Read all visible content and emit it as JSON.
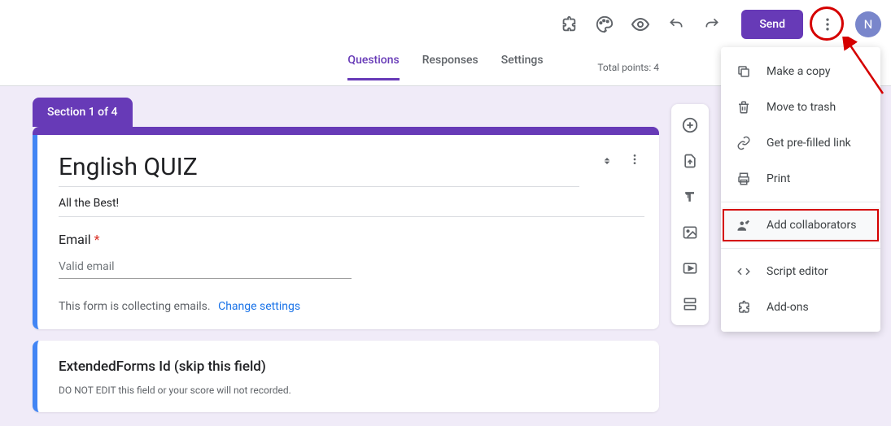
{
  "topbar": {
    "send_label": "Send",
    "avatar_initial": "N"
  },
  "tabs": {
    "questions": "Questions",
    "responses": "Responses",
    "settings": "Settings"
  },
  "total_points": "Total points: 4",
  "section_label": "Section 1 of 4",
  "form": {
    "title": "English QUIZ",
    "description": "All the Best!",
    "email_label": "Email",
    "email_required_mark": "*",
    "email_placeholder": "Valid email",
    "collecting_text": "This form is collecting emails.",
    "change_settings": "Change settings"
  },
  "question2": {
    "title": "ExtendedForms Id (skip this field)",
    "desc": "DO NOT EDIT this field or your score will not recorded."
  },
  "menu": {
    "make_copy": "Make a copy",
    "move_trash": "Move to trash",
    "prefilled": "Get pre-filled link",
    "print": "Print",
    "add_collab": "Add collaborators",
    "script_editor": "Script editor",
    "addons": "Add-ons"
  }
}
